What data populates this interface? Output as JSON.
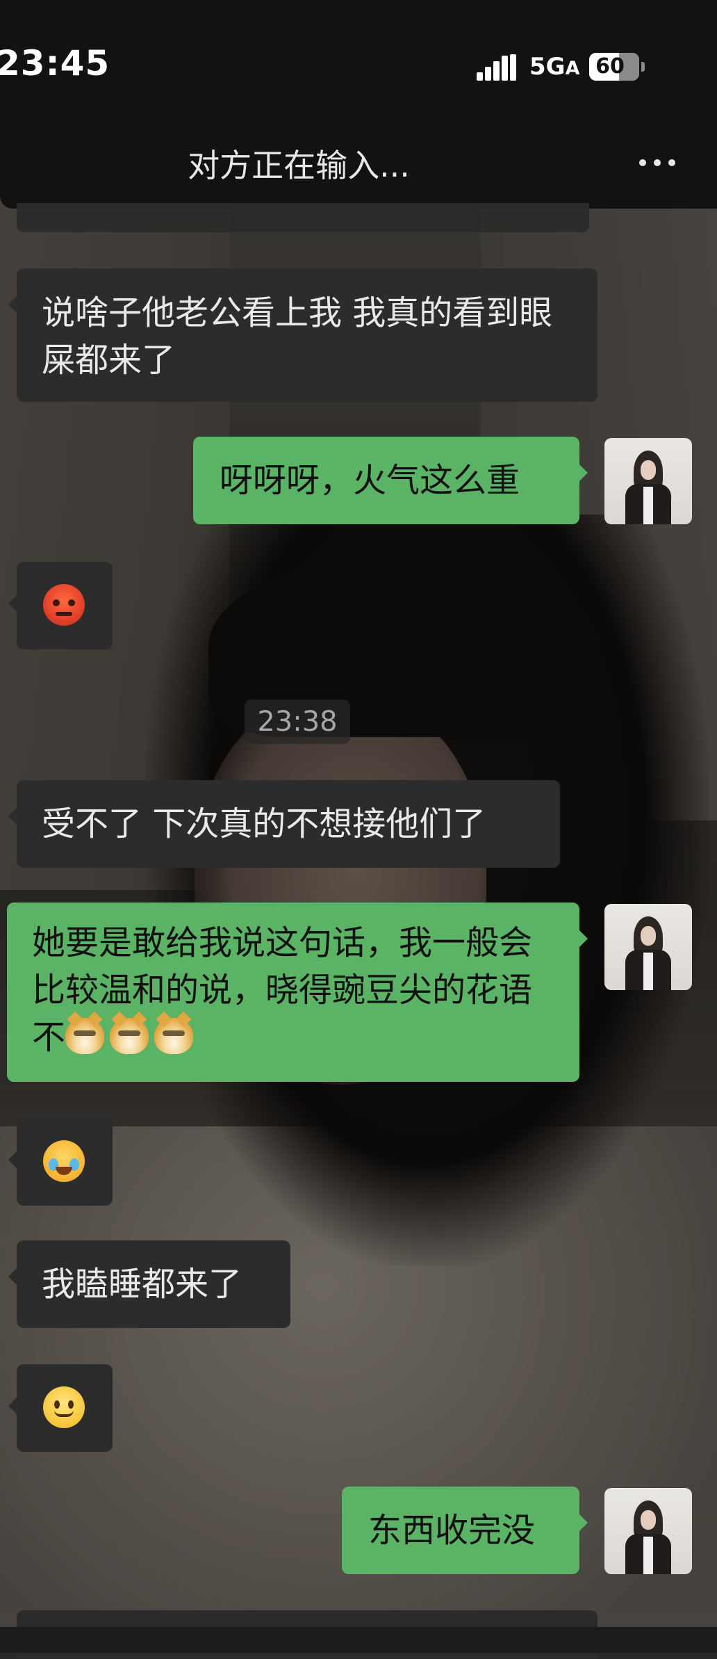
{
  "status_bar": {
    "time": "23:45",
    "network": "5G",
    "network_suffix": "A",
    "battery": "60",
    "battery_level": 0.6
  },
  "header": {
    "title": "对方正在输入..."
  },
  "messages": [
    {
      "side": "in",
      "type": "text",
      "text": "说啥子他老公看上我 我真的看到眼屎都来了"
    },
    {
      "side": "out",
      "type": "text",
      "text": "呀呀呀，火气这么重"
    },
    {
      "side": "in",
      "type": "emoji",
      "icon": "angry-face-emoji"
    },
    {
      "type": "timestamp",
      "text": "23:38"
    },
    {
      "side": "in",
      "type": "text",
      "text": "受不了 下次真的不想接他们了"
    },
    {
      "side": "out",
      "type": "text",
      "text": "她要是敢给我说这句话，我一般会比较温和的说，晓得豌豆尖的花语不",
      "trailing_icons": [
        "doge-emoji",
        "doge-emoji",
        "doge-emoji"
      ]
    },
    {
      "side": "in",
      "type": "emoji",
      "icon": "crying-laughing-face-emoji"
    },
    {
      "side": "in",
      "type": "text",
      "text": "我瞌睡都来了"
    },
    {
      "side": "in",
      "type": "emoji",
      "icon": "slightly-smiling-face-emoji"
    },
    {
      "side": "out",
      "type": "text",
      "text": "东西收完没"
    }
  ],
  "colors": {
    "outgoing_bubble": "#5bb366",
    "incoming_bubble": "#2c2c2c",
    "header_bg": "#121212"
  }
}
